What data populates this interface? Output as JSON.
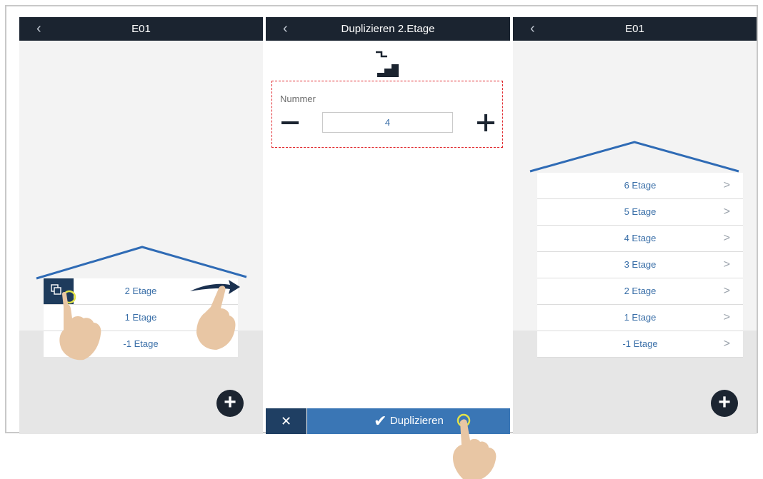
{
  "panels": [
    {
      "title": "E01",
      "back_icon": "chevron-left-icon",
      "rows": [
        "2 Etage",
        "1 Etage",
        "-1 Etage"
      ]
    },
    {
      "title": "Duplizieren 2.Etage",
      "back_icon": "chevron-left-icon",
      "number_label": "Nummer",
      "number_value": "4",
      "cancel_icon": "close-icon",
      "confirm_label": "Duplizieren"
    },
    {
      "title": "E01",
      "back_icon": "chevron-left-icon",
      "rows": [
        "6 Etage",
        "5 Etage",
        "4 Etage",
        "3 Etage",
        "2 Etage",
        "1 Etage",
        "-1 Etage"
      ]
    }
  ],
  "colors": {
    "header": "#1b2430",
    "accent": "#3a6fa8",
    "roof": "#2f6bb5",
    "highlight": "#e2e34a",
    "dash": "#e0262b"
  }
}
